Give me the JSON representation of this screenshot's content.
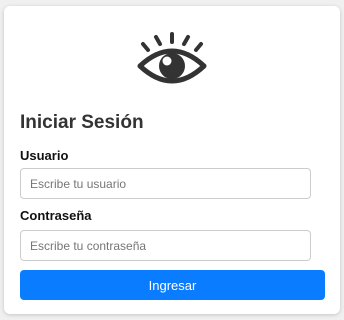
{
  "login": {
    "icon": "eye-icon",
    "title": "Iniciar Sesión",
    "username_label": "Usuario",
    "username_placeholder": "Escribe tu usuario",
    "username_value": "",
    "password_label": "Contraseña",
    "password_placeholder": "Escribe tu contraseña",
    "password_value": "",
    "submit_label": "Ingresar"
  },
  "colors": {
    "accent": "#0a7cff",
    "icon": "#333333",
    "background": "#f0f0f0",
    "card": "#ffffff"
  }
}
